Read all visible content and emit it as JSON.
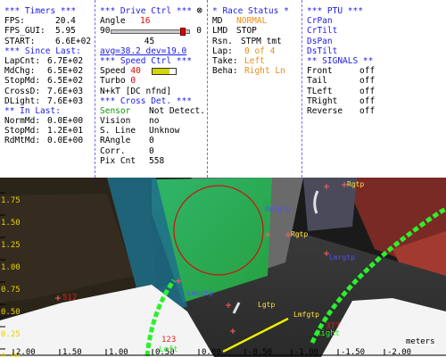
{
  "timers": {
    "title": "*** Timers ***",
    "fps_label": "FPS:",
    "fps": "20.4",
    "fps_gui_label": "FPS_GUI:",
    "fps_gui": "5.95",
    "start_label": "START:",
    "start": "6.6E+02",
    "since_header": "*** Since Last:",
    "lapcnt_label": "LapCnt:",
    "lapcnt": "6.7E+02",
    "mdchg_label": "MdChg:",
    "mdchg": "6.5E+02",
    "stopmd_label": "StopMd:",
    "stopmd": "6.5E+02",
    "crossd_label": "CrossD:",
    "crossd": "7.6E+03",
    "dlight_label": "DLight:",
    "dlight": "7.6E+03",
    "inlast_header": "** In Last:",
    "normmd_label": "NormMd:",
    "normmd": "0.0E+00",
    "stopmd2_label": "StopMd:",
    "stopmd2": "1.2E+01",
    "rdmtmd_label": "RdMtMd:",
    "rdmtmd": "0.0E+00"
  },
  "drive": {
    "title": "***  Drive Ctrl  ***",
    "close_glyph": "⊗",
    "angle_label": "Angle",
    "angle": "16",
    "gauge_min": "90",
    "gauge_max": "0",
    "gauge_level": 0.9,
    "gauge_center": "45",
    "avg_dev": "avg=38.2  dev=19.0",
    "speed_header": "*** Speed Ctrl ***",
    "speed_label": "Speed",
    "speed": "40",
    "speed_level": 0.75,
    "turbo_label": "Turbo",
    "turbo": "0",
    "nkt": "N+kT [DC nfnd]",
    "cross_header": "*** Cross Det. ***",
    "sensor_label": "Sensor",
    "sensor": "Not Detect.",
    "vision_label": "Vision",
    "vision": "no",
    "sline_label": "S. Line",
    "sline": "Unknow",
    "rangle_label": "RAngle",
    "rangle": "0",
    "corr_label": "Corr.",
    "corr": "0",
    "pixcnt_label": "Pix Cnt",
    "pixcnt": "558"
  },
  "race": {
    "title": "* Race Status *",
    "md_label": "MD",
    "md": "NORMAL",
    "lmd_label": "LMD",
    "lmd": "STOP",
    "rsn_label": "Rsn.",
    "rsn": "STPM tmt",
    "lap_label": "Lap:",
    "lap": "0 of 4",
    "take_label": "Take:",
    "take": "Left",
    "beha_label": "Beha:",
    "beha": "Right Ln"
  },
  "ptu": {
    "title": "*** PTU ***",
    "items": [
      "CrPan",
      "CrTilt",
      "DsPan",
      "DsTilt"
    ],
    "signals_header": "** SIGNALS **",
    "signals": [
      {
        "label": "Front",
        "value": "off"
      },
      {
        "label": "Tail",
        "value": "off"
      },
      {
        "label": "TLeft",
        "value": "off"
      },
      {
        "label": "TRight",
        "value": "off"
      },
      {
        "label": "Reverse",
        "value": "off"
      }
    ]
  },
  "camera": {
    "y_ticks": [
      "1.75",
      "1.50",
      "1.25",
      "1.00",
      "0.75",
      "0.50",
      "0.25",
      "0.00"
    ],
    "x_ticks": [
      "2.00",
      "1.50",
      "1.00",
      "0.50",
      "0.00",
      "-0.50",
      "-1.00",
      "-1.50",
      "-2.00"
    ],
    "unit": "meters",
    "labels": {
      "rgtp_top": "Rgtp",
      "rmfgtp": "Rmfgtp",
      "rgtp": "Rgtp",
      "lmrgtp": "Lmrgtp",
      "lmcgtp": "Lmcgtp",
      "lgtp": "Lgtp",
      "lmfgtp": "Lmfgtp",
      "n517": "517",
      "n123": "123",
      "n377": "377",
      "left": "Left",
      "right": "Right"
    },
    "colors": {
      "lane": "#2cf02c",
      "target_circle": "#d01010",
      "heading": "#f0f000",
      "grid": "#000000"
    }
  }
}
